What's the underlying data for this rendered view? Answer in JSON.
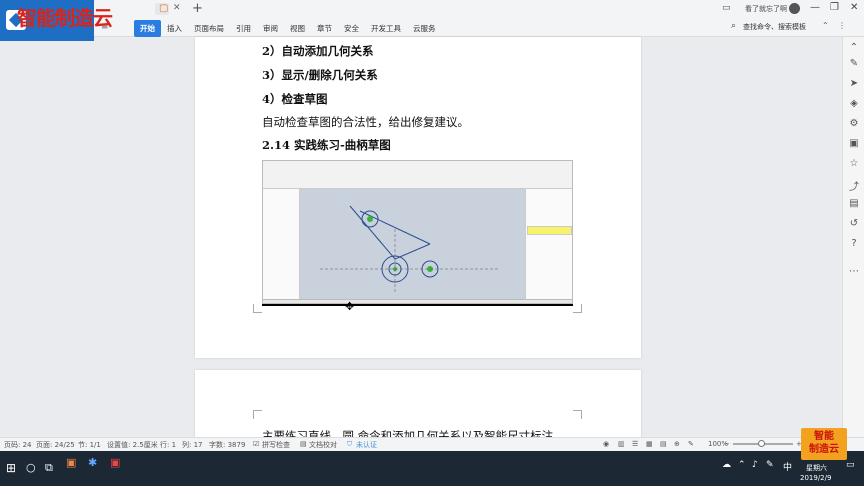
{
  "window": {
    "logo_text": "智能制造云",
    "watch_label": "看了就忘了啊",
    "new_tab_glyph": "+"
  },
  "ribbon": {
    "menu": [
      "开始",
      "插入",
      "页面布局",
      "引用",
      "审阅",
      "视图",
      "章节",
      "安全",
      "开发工具",
      "云服务"
    ],
    "active": "开始",
    "search_placeholder": "查找命令、搜索模板"
  },
  "document": {
    "lines": [
      "2）自动添加几何关系",
      "3）显示/删除几何关系",
      "4）检查草图",
      "自动检查草图的合法性，给出修复建议。",
      "2.14 实践练习-曲柄草图"
    ],
    "page2_line": "主要练习直线、圆 命令和添加几何关系以及智能尺寸标注"
  },
  "statusbar": {
    "page": "页码: 24",
    "pages": "页面: 24/25",
    "section": "节: 1/1",
    "setting": "设置值: 2.5厘米",
    "row": "行: 1",
    "col": "列: 17",
    "words": "字数: 3879",
    "spell": "拼写检查",
    "proof": "文档校对",
    "cert": "未认证",
    "zoom": "100%"
  },
  "taskbar": {
    "time": "星期六",
    "date": "2019/2/9",
    "ime": "中"
  },
  "watermark": {
    "line1": "智能",
    "line2": "制造云"
  },
  "colors": {
    "accent": "#2b7ce0",
    "brand_blue": "#1e6fc4",
    "brand_red": "#d9241c",
    "taskbar": "#1c2833",
    "watermark_bg": "#f2a21e"
  }
}
